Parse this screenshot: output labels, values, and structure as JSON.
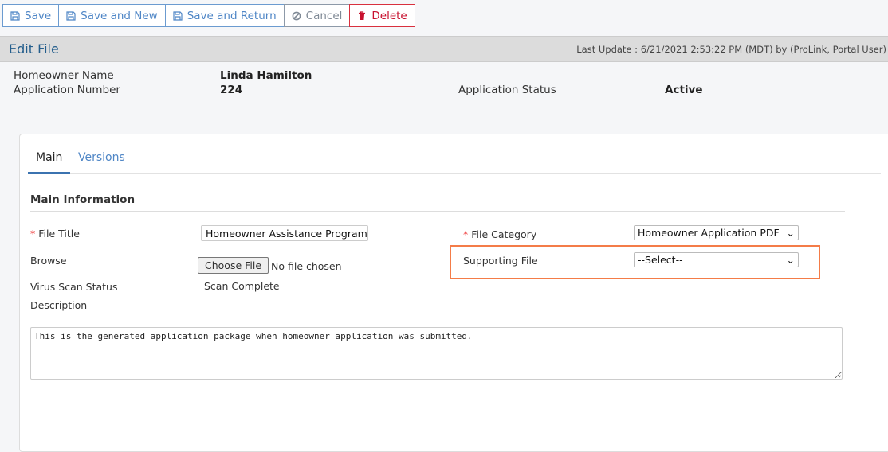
{
  "toolbar": {
    "save": "Save",
    "save_new": "Save and New",
    "save_return": "Save and Return",
    "cancel": "Cancel",
    "delete": "Delete"
  },
  "header": {
    "title": "Edit File",
    "last_update": "Last Update : 6/21/2021 2:53:22 PM (MDT) by (ProLink, Portal User)"
  },
  "summary": {
    "homeowner_label": "Homeowner Name",
    "homeowner": "Linda Hamilton",
    "app_no_label": "Application Number",
    "app_no": "224",
    "status_label": "Application Status",
    "status": "Active"
  },
  "tabs": [
    "Main",
    "Versions"
  ],
  "form": {
    "section": "Main Information",
    "required_mark": "*",
    "file_title_label": "File Title",
    "file_title": "Homeowner Assistance Program Su",
    "browse_label": "Browse",
    "choose_file": "Choose File",
    "no_file": "No file chosen",
    "virus_label": "Virus Scan Status",
    "virus": "Scan Complete",
    "description_label": "Description",
    "description": "This is the generated application package when homeowner application was submitted.",
    "category_label": "File Category",
    "category": "Homeowner Application PDF",
    "supporting_label": "Supporting File",
    "supporting": "--Select--"
  },
  "colors": {
    "accent": "#4f86c6",
    "delete": "#c8102e",
    "highlight": "#f47c48"
  }
}
